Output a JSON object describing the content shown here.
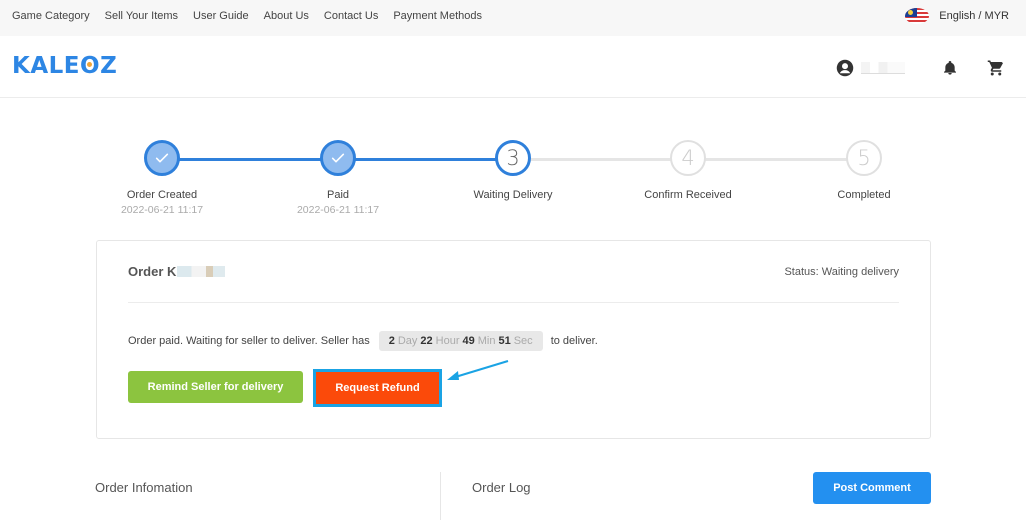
{
  "topbar": {
    "nav": [
      "Game Category",
      "Sell Your Items",
      "User Guide",
      "About Us",
      "Contact Us",
      "Payment Methods"
    ],
    "language": "English / MYR",
    "flag_icon": "malaysia-flag-icon"
  },
  "header": {
    "logo": "KALEOZ",
    "icons": [
      "account-icon",
      "bell-icon",
      "cart-icon"
    ]
  },
  "stepper": {
    "steps": [
      {
        "label": "Order Created",
        "date": "2022-06-21 11:17",
        "state": "done",
        "number": "1"
      },
      {
        "label": "Paid",
        "date": "2022-06-21 11:17",
        "state": "done",
        "number": "2"
      },
      {
        "label": "Waiting Delivery",
        "date": "",
        "state": "active",
        "number": "3"
      },
      {
        "label": "Confirm Received",
        "date": "",
        "state": "todo",
        "number": "4"
      },
      {
        "label": "Completed",
        "date": "",
        "state": "todo",
        "number": "5"
      }
    ],
    "colors": {
      "active": "#2f80db",
      "inactive": "#e0e0e0"
    }
  },
  "order": {
    "title_prefix": "Order K",
    "status": "Status: Waiting delivery",
    "message_before": "Order paid. Waiting for seller to deliver. Seller has",
    "message_after": "to deliver.",
    "countdown": {
      "days": "2",
      "days_label": "Day",
      "hours": "22",
      "hours_label": "Hour",
      "minutes": "49",
      "minutes_label": "Min",
      "seconds": "51",
      "seconds_label": "Sec"
    },
    "remind_button": "Remind Seller for delivery",
    "refund_button": "Request Refund"
  },
  "bottom": {
    "order_information": "Order Infomation",
    "order_log": "Order Log",
    "post_comment": "Post Comment"
  }
}
